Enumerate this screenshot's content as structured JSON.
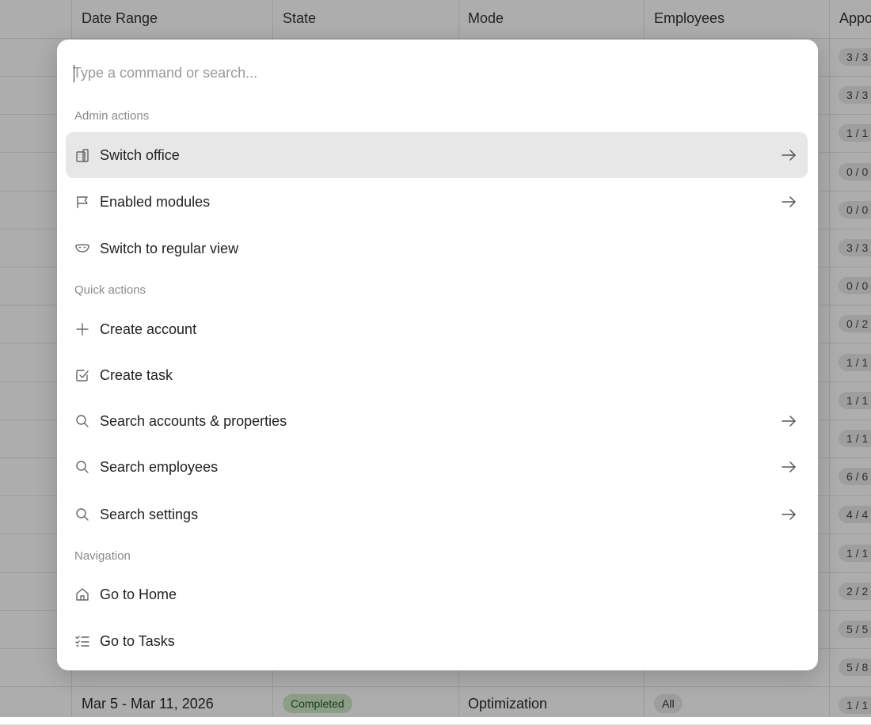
{
  "table": {
    "headers": {
      "date_range": "Date Range",
      "state": "State",
      "mode": "Mode",
      "employees": "Employees",
      "approvals": "Appo"
    },
    "approvals": [
      "3 / 3",
      "3 / 3",
      "1 / 1",
      "0 / 0",
      "0 / 0",
      "3 / 3",
      "0 / 0",
      "0 / 2",
      "1 / 1",
      "1 / 1",
      "1 / 1",
      "6 / 6",
      "4 / 4",
      "1 / 1",
      "2 / 2",
      "5 / 5",
      "5 / 8",
      "1 / 1"
    ],
    "last_row": {
      "date_range": "Mar 5 - Mar 11, 2026",
      "state": "Completed",
      "mode": "Optimization",
      "employees": "All"
    }
  },
  "palette": {
    "search_placeholder": "Type a command or search...",
    "groups": {
      "admin": "Admin actions",
      "quick": "Quick actions",
      "navigation": "Navigation"
    },
    "items": {
      "switch_office": "Switch office",
      "enabled_modules": "Enabled modules",
      "switch_regular_view": "Switch to regular view",
      "create_account": "Create account",
      "create_task": "Create task",
      "search_accounts": "Search accounts & properties",
      "search_employees": "Search employees",
      "search_settings": "Search settings",
      "go_home": "Go to Home",
      "go_tasks": "Go to Tasks"
    }
  },
  "icons": {
    "switch_office": "building-icon",
    "enabled_modules": "flag-icon",
    "switch_regular_view": "mask-icon",
    "create_account": "plus-icon",
    "create_task": "checkbox-icon",
    "search": "search-icon",
    "go_home": "home-icon",
    "go_tasks": "checklist-icon",
    "submenu": "arrow-right-icon"
  },
  "colors": {
    "active_item_bg": "#e7e7e7",
    "completed_badge_bg": "#cfe8c9",
    "overlay": "rgba(0,0,0,0.32)"
  }
}
